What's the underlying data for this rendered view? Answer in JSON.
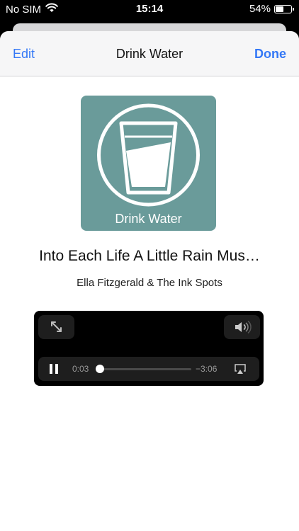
{
  "status_bar": {
    "carrier": "No SIM",
    "time": "15:14",
    "battery_percent": "54%",
    "battery_level": 0.54
  },
  "nav": {
    "edit_label": "Edit",
    "title": "Drink Water",
    "done_label": "Done"
  },
  "artwork": {
    "label": "Drink Water",
    "icon": "glass-of-water-icon",
    "background_color": "#6a9b9a"
  },
  "track": {
    "title": "Into Each Life A Little Rain Mus…",
    "artist": "Ella Fitzgerald & The Ink Spots"
  },
  "player": {
    "elapsed": "0:03",
    "remaining": "−3:06",
    "progress": 0.016
  },
  "colors": {
    "accent": "#3478f6"
  }
}
